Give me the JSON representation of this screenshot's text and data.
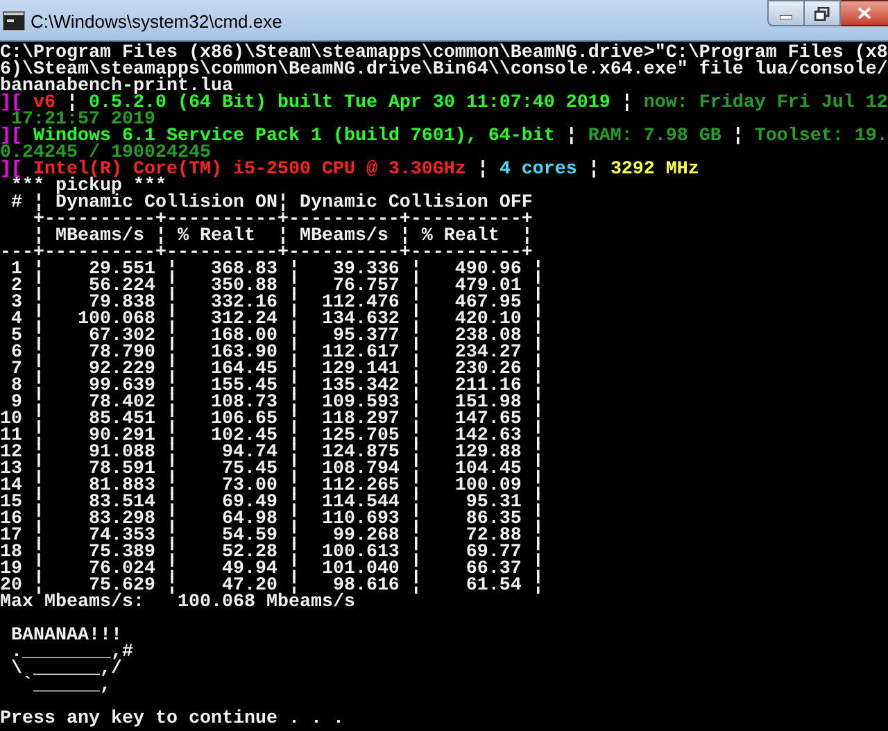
{
  "window": {
    "title": "C:\\Windows\\system32\\cmd.exe"
  },
  "console_lines": [
    {
      "segments": [
        {
          "text": "C:\\Program Files (x86)\\Steam\\steamapps\\common\\BeamNG.drive>\"C:\\Program Files (x8",
          "color": "#f0f0f0"
        }
      ]
    },
    {
      "segments": [
        {
          "text": "6)\\Steam\\steamapps\\common\\BeamNG.drive\\Bin64\\\\console.x64.exe\" file lua/console/",
          "color": "#f0f0f0"
        }
      ]
    },
    {
      "segments": [
        {
          "text": "bananabench-print.lua",
          "color": "#f0f0f0"
        }
      ]
    },
    {
      "segments": [
        {
          "text": "][",
          "color": "#ff00ff"
        },
        {
          "text": " v6 ",
          "color": "#ff2020"
        },
        {
          "text": "¦ ",
          "color": "#f0f0f0"
        },
        {
          "text": "0.5.2.0 (64 Bit) built Tue Apr 30 11:07:40 2019 ",
          "color": "#20ff20"
        },
        {
          "text": "¦ ",
          "color": "#f0f0f0"
        },
        {
          "text": "now: Friday Fri Jul 12",
          "color": "#22a022"
        }
      ]
    },
    {
      "segments": [
        {
          "text": " 17:21:57 2019",
          "color": "#22a022"
        }
      ]
    },
    {
      "segments": [
        {
          "text": "][",
          "color": "#ff00ff"
        },
        {
          "text": " Windows 6.1 Service Pack 1 (build 7601), 64-bit ",
          "color": "#20ff20"
        },
        {
          "text": "¦ ",
          "color": "#f0f0f0"
        },
        {
          "text": "RAM: 7.98 GB ",
          "color": "#22a022"
        },
        {
          "text": "¦ ",
          "color": "#f0f0f0"
        },
        {
          "text": "Toolset: 19.",
          "color": "#22a022"
        }
      ]
    },
    {
      "segments": [
        {
          "text": "0.24245 / 190024245",
          "color": "#22a022"
        }
      ]
    },
    {
      "segments": [
        {
          "text": "][",
          "color": "#ff00ff"
        },
        {
          "text": " Intel(R) Core(TM) i5-2500 CPU @ 3.30GHz ",
          "color": "#ff2020"
        },
        {
          "text": "¦ ",
          "color": "#f0f0f0"
        },
        {
          "text": "4 cores ",
          "color": "#40e0ff"
        },
        {
          "text": "¦ ",
          "color": "#f0f0f0"
        },
        {
          "text": "3292 MHz",
          "color": "#ffff40"
        }
      ]
    },
    {
      "segments": [
        {
          "text": " *** pickup ***",
          "color": "#f0f0f0"
        }
      ]
    },
    {
      "segments": [
        {
          "text": " # ¦ Dynamic Collision ON¦ Dynamic Collision OFF",
          "color": "#f0f0f0"
        }
      ]
    },
    {
      "segments": [
        {
          "text": "   +----------+----------+----------+----------+",
          "color": "#f0f0f0"
        }
      ]
    },
    {
      "segments": [
        {
          "text": "   ¦ MBeams/s ¦ % Realt  ¦ MBeams/s ¦ % Realt  ¦",
          "color": "#f0f0f0"
        }
      ]
    },
    {
      "segments": [
        {
          "text": "---+----------+----------+----------+----------+",
          "color": "#f0f0f0"
        }
      ]
    },
    {
      "segments": [
        {
          "text": " 1 ¦    29.551 ¦   368.83 ¦   39.336 ¦   490.96 ¦",
          "color": "#f0f0f0"
        }
      ]
    },
    {
      "segments": [
        {
          "text": " 2 ¦    56.224 ¦   350.88 ¦   76.757 ¦   479.01 ¦",
          "color": "#f0f0f0"
        }
      ]
    },
    {
      "segments": [
        {
          "text": " 3 ¦    79.838 ¦   332.16 ¦  112.476 ¦   467.95 ¦",
          "color": "#f0f0f0"
        }
      ]
    },
    {
      "segments": [
        {
          "text": " 4 ¦   100.068 ¦   312.24 ¦  134.632 ¦   420.10 ¦",
          "color": "#f0f0f0"
        }
      ]
    },
    {
      "segments": [
        {
          "text": " 5 ¦    67.302 ¦   168.00 ¦   95.377 ¦   238.08 ¦",
          "color": "#f0f0f0"
        }
      ]
    },
    {
      "segments": [
        {
          "text": " 6 ¦    78.790 ¦   163.90 ¦  112.617 ¦   234.27 ¦",
          "color": "#f0f0f0"
        }
      ]
    },
    {
      "segments": [
        {
          "text": " 7 ¦    92.229 ¦   164.45 ¦  129.141 ¦   230.26 ¦",
          "color": "#f0f0f0"
        }
      ]
    },
    {
      "segments": [
        {
          "text": " 8 ¦    99.639 ¦   155.45 ¦  135.342 ¦   211.16 ¦",
          "color": "#f0f0f0"
        }
      ]
    },
    {
      "segments": [
        {
          "text": " 9 ¦    78.402 ¦   108.73 ¦  109.593 ¦   151.98 ¦",
          "color": "#f0f0f0"
        }
      ]
    },
    {
      "segments": [
        {
          "text": "10 ¦    85.451 ¦   106.65 ¦  118.297 ¦   147.65 ¦",
          "color": "#f0f0f0"
        }
      ]
    },
    {
      "segments": [
        {
          "text": "11 ¦    90.291 ¦   102.45 ¦  125.705 ¦   142.63 ¦",
          "color": "#f0f0f0"
        }
      ]
    },
    {
      "segments": [
        {
          "text": "12 ¦    91.088 ¦    94.74 ¦  124.875 ¦   129.88 ¦",
          "color": "#f0f0f0"
        }
      ]
    },
    {
      "segments": [
        {
          "text": "13 ¦    78.591 ¦    75.45 ¦  108.794 ¦   104.45 ¦",
          "color": "#f0f0f0"
        }
      ]
    },
    {
      "segments": [
        {
          "text": "14 ¦    81.883 ¦    73.00 ¦  112.265 ¦   100.09 ¦",
          "color": "#f0f0f0"
        }
      ]
    },
    {
      "segments": [
        {
          "text": "15 ¦    83.514 ¦    69.49 ¦  114.544 ¦    95.31 ¦",
          "color": "#f0f0f0"
        }
      ]
    },
    {
      "segments": [
        {
          "text": "16 ¦    83.298 ¦    64.98 ¦  110.693 ¦    86.35 ¦",
          "color": "#f0f0f0"
        }
      ]
    },
    {
      "segments": [
        {
          "text": "17 ¦    74.353 ¦    54.59 ¦   99.268 ¦    72.88 ¦",
          "color": "#f0f0f0"
        }
      ]
    },
    {
      "segments": [
        {
          "text": "18 ¦    75.389 ¦    52.28 ¦  100.613 ¦    69.77 ¦",
          "color": "#f0f0f0"
        }
      ]
    },
    {
      "segments": [
        {
          "text": "19 ¦    76.024 ¦    49.94 ¦  101.040 ¦    66.37 ¦",
          "color": "#f0f0f0"
        }
      ]
    },
    {
      "segments": [
        {
          "text": "20 ¦    75.629 ¦    47.20 ¦   98.616 ¦    61.54 ¦",
          "color": "#f0f0f0"
        }
      ]
    },
    {
      "segments": [
        {
          "text": "Max Mbeams/s:   100.068 Mbeams/s",
          "color": "#f0f0f0"
        }
      ]
    },
    {
      "kind": "blank"
    },
    {
      "segments": [
        {
          "text": " BANANAA!!!",
          "color": "#f0f0f0"
        }
      ]
    },
    {
      "segments": [
        {
          "text": " .________,#",
          "color": "#f0f0f0"
        }
      ]
    },
    {
      "segments": [
        {
          "text": " \\ ______,/",
          "color": "#f0f0f0"
        }
      ]
    },
    {
      "segments": [
        {
          "text": "  `______,",
          "color": "#f0f0f0"
        }
      ]
    },
    {
      "kind": "blank"
    },
    {
      "segments": [
        {
          "text": "Press any key to continue . . .",
          "color": "#f0f0f0"
        }
      ]
    }
  ]
}
